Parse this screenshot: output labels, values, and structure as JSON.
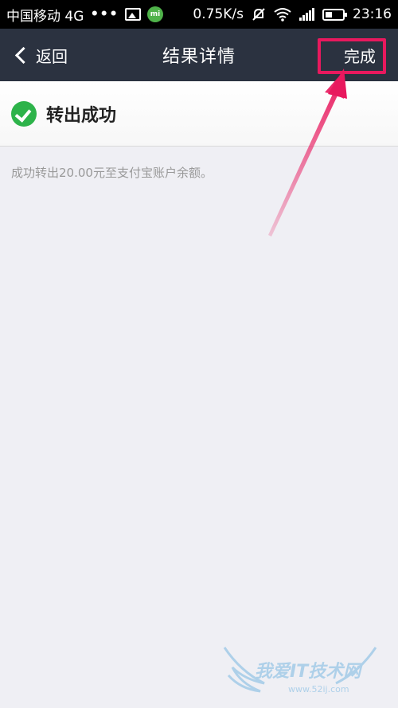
{
  "status_bar": {
    "carrier": "中国移动 4G",
    "dots": "•••",
    "speed": "0.75K/s",
    "time": "23:16"
  },
  "nav": {
    "back_label": "返回",
    "title": "结果详情",
    "done_label": "完成"
  },
  "result": {
    "title": "转出成功",
    "description": "成功转出20.00元至支付宝账户余额。"
  },
  "watermark": {
    "text": "我爱IT技术网",
    "url": "www.52ij.com"
  },
  "colors": {
    "nav_bg": "#2b3240",
    "success_green": "#2db34a",
    "annotation_pink": "#e8195e",
    "page_bg": "#efeff4"
  }
}
